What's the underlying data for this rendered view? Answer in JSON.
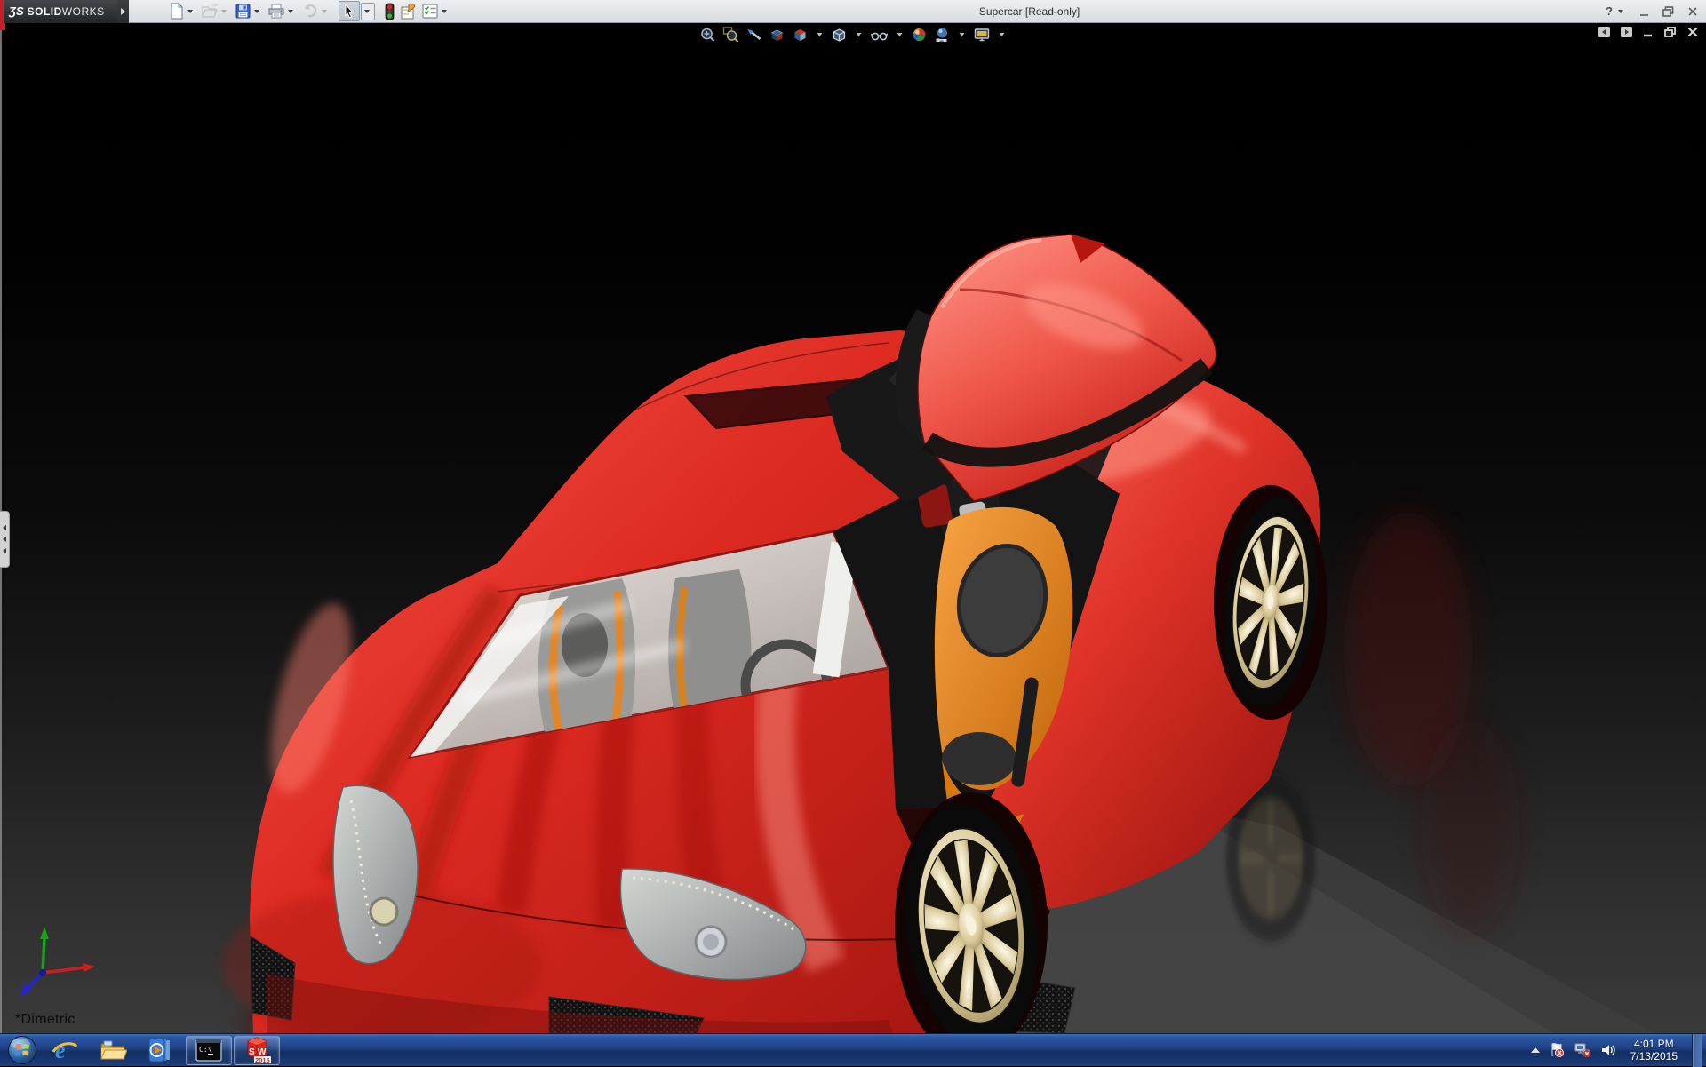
{
  "titlebar": {
    "logo": {
      "prefix": "ƷS",
      "solid": "SOLID",
      "works": "WORKS"
    },
    "title": "Supercar [Read-only]",
    "help_glyph": "?",
    "toolbar_icons": [
      "new-document",
      "open",
      "save",
      "print",
      "undo",
      "select",
      "traffic-light",
      "comment",
      "design-checker"
    ],
    "window_controls": [
      "help",
      "minimize",
      "restore",
      "close"
    ]
  },
  "hud_toolbar": {
    "icons": [
      "zoom-to-fit",
      "zoom-to-area",
      "previous-view",
      "section-view",
      "view-orientation",
      "display-style",
      "hide-show-items",
      "edit-appearance",
      "apply-scene",
      "view-settings"
    ]
  },
  "viewport": {
    "view_label": "*Dimetric",
    "window_controls": [
      "collapse-pane-left",
      "collapse-pane-right",
      "minimize",
      "restore",
      "close"
    ],
    "triad_axes": [
      "x-red",
      "y-green",
      "z-blue"
    ],
    "model": "red supercar with open gullwing door"
  },
  "taskbar": {
    "items": [
      "start",
      "internet-explorer",
      "windows-explorer",
      "windows-media-player",
      "command-prompt",
      "solidworks-2015"
    ],
    "cmd_text": "C:\\",
    "sw_badge": {
      "s": "S",
      "w": "W",
      "year": "2015"
    },
    "tray": {
      "time": "4:01 PM",
      "date": "7/13/2015",
      "icons": [
        "show-hidden-icons",
        "action-center",
        "network-status",
        "volume"
      ]
    }
  },
  "colors": {
    "car_red": "#d8251d",
    "seat_orange": "#e8861c",
    "taskbar_blue": "#1e4488",
    "titlebar_bg": "#dde0e4",
    "logo_bg": "#2f3133",
    "accent_red": "#c81e25"
  }
}
